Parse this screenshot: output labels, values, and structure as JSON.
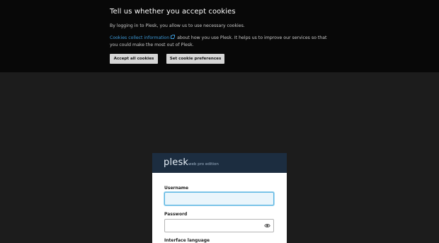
{
  "cookie_banner": {
    "title": "Tell us whether you accept cookies",
    "paragraph1": "By logging in to Plesk, you allow us to use necessary cookies.",
    "link_text": "Cookies collect information",
    "paragraph2_rest": "about how you use Plesk. It helps us to improve our services so that you could make the most out of Plesk.",
    "accept_button": "Accept all cookies",
    "prefs_button": "Set cookie preferences",
    "link_color": "#3d9ad8"
  },
  "login": {
    "logo_text": "plesk",
    "edition_text": "web pro edition",
    "username_label": "Username",
    "username_value": "",
    "password_label": "Password",
    "password_value": "",
    "language_label": "Interface language",
    "password_toggle_icon": "eye-icon",
    "header_color": "#1c2d40",
    "focus_color": "#58b4e1"
  }
}
